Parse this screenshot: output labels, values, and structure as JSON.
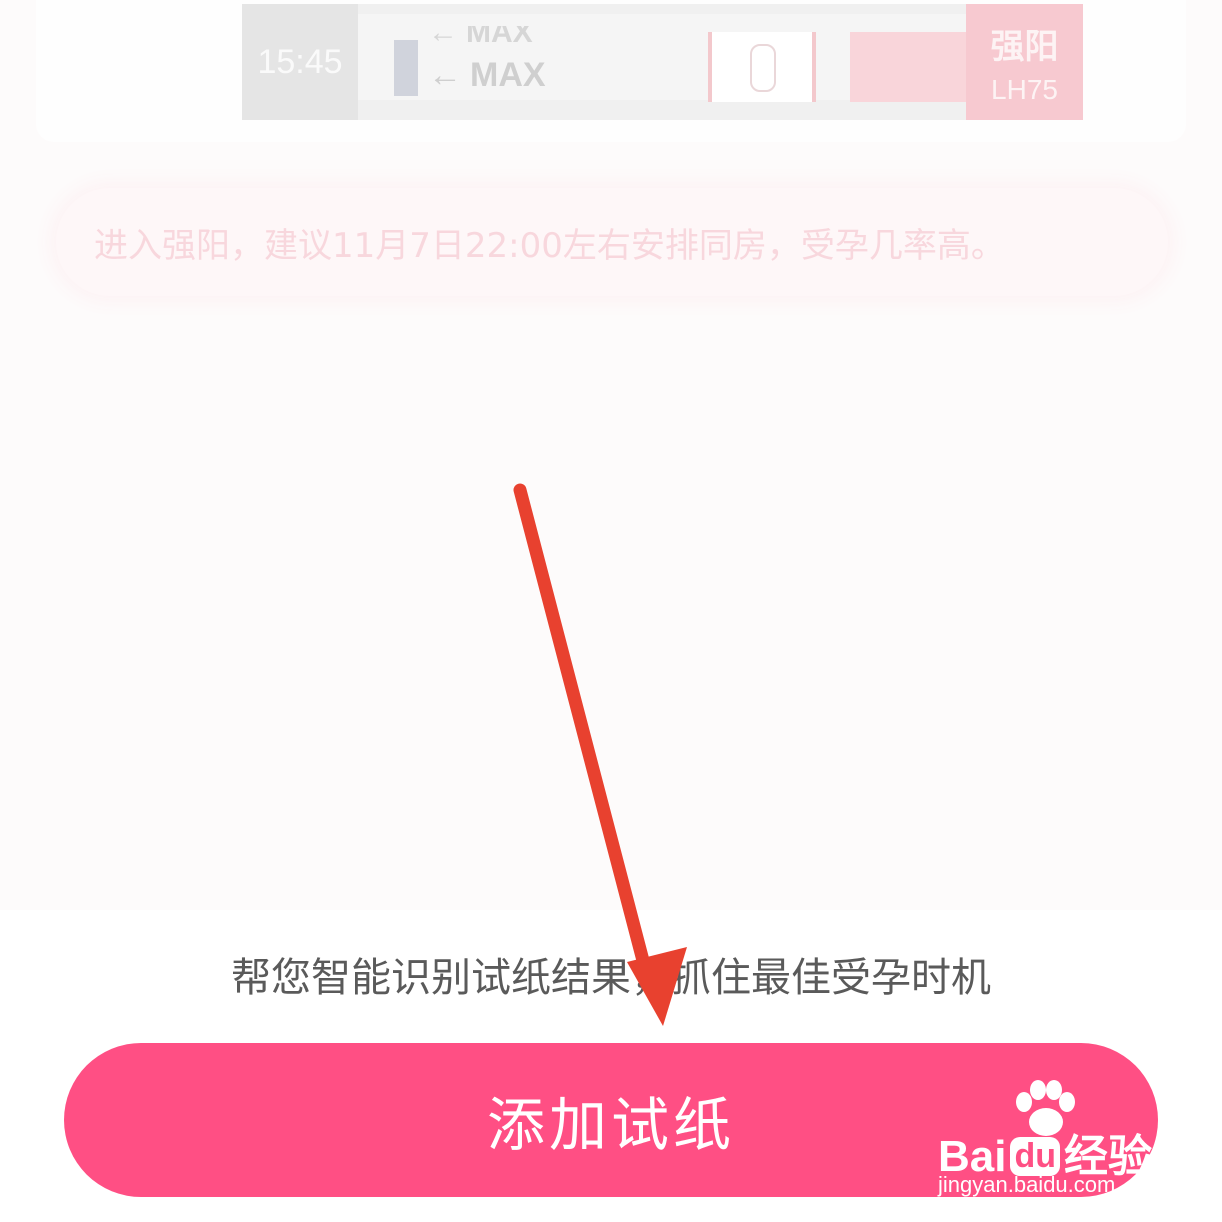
{
  "lh_result": {
    "time": "15:45",
    "stick_label_upper": "MAX",
    "stick_label_lower": "MAX",
    "level": "强阳",
    "value": "LH75"
  },
  "advice_text": "进入强阳，建议11月7日22:00左右安排同房，受孕几率高。",
  "tagline": "帮您智能识别试纸结果，抓住最佳受孕时机",
  "add_button_label": "添加试纸",
  "colors": {
    "primary_button": "#ff4f84",
    "annotation_arrow": "#e8412f"
  },
  "watermark": {
    "brand_prefix": "Bai",
    "brand_du": "du",
    "brand_suffix": "经验",
    "domain": "jingyan.baidu.com"
  }
}
